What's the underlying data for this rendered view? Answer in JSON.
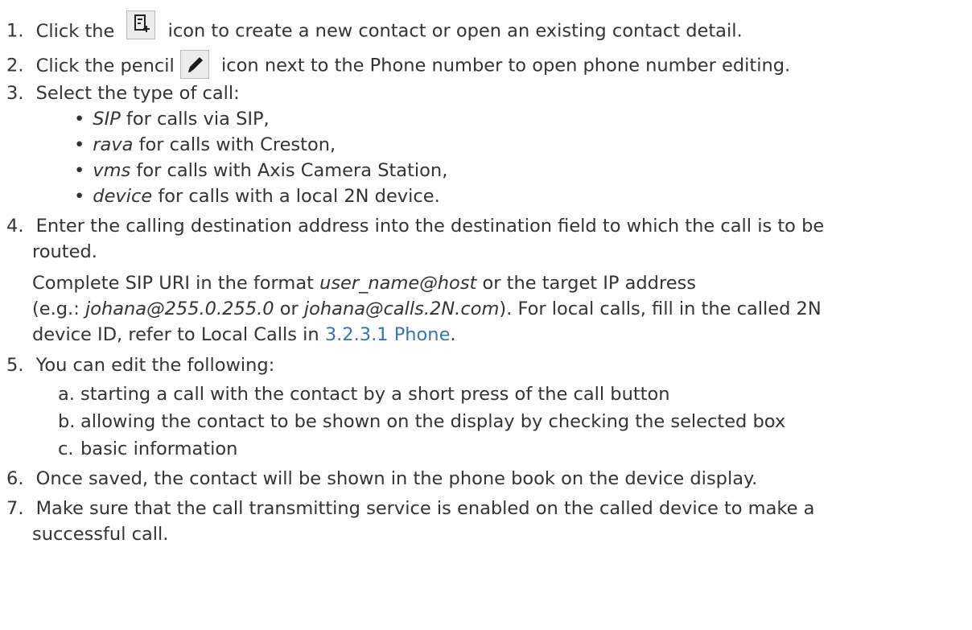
{
  "steps": [
    {
      "num": "1.",
      "parts": [
        "Click the ",
        "icon to create a new contact or open an existing contact detail."
      ],
      "icon": "add-contact-icon"
    },
    {
      "num": "2.",
      "parts": [
        "Click the pencil ",
        "icon next to the Phone number to open phone number editing."
      ],
      "icon": "pencil-icon"
    },
    {
      "num": "3.",
      "text": "Select the type of call:"
    },
    {
      "num": "4.",
      "lines": [
        "Enter the calling destination address into the destination field to which the call is to be",
        "routed."
      ]
    },
    {
      "num": "5.",
      "text": "You can edit the following:"
    },
    {
      "num": "6.",
      "text": "Once saved, the contact will be shown in the phone book on the device display."
    },
    {
      "num": "7.",
      "lines": [
        "Make sure that the call transmitting service is enabled on the called device to make a",
        "successful call."
      ]
    }
  ],
  "call_types": [
    {
      "term": "SIP",
      "rest": " for calls via SIP,"
    },
    {
      "term": "rava",
      "rest": " for calls with Creston,"
    },
    {
      "term": "vms",
      "rest": " for calls with Axis Camera Station,"
    },
    {
      "term": "device",
      "rest": " for calls with a local 2N device."
    }
  ],
  "step4_detail": {
    "l1_a": "Complete SIP URI in the format ",
    "l1_em": "user_name@host",
    "l1_b": " or the target IP address",
    "l2_a": "(e.g.: ",
    "l2_em1": "johana@255.0.255.0",
    "l2_b": " or ",
    "l2_em2": "johana@calls.2N.com",
    "l2_c": "). For local calls, fill in the called 2N",
    "l3_a": "device ID, refer to Local Calls in ",
    "l3_link": "3.2.3.1 Phone",
    "l3_b": "."
  },
  "edit_options": [
    {
      "letter": "a.",
      "text": "starting a call with the contact by a short press of the call button"
    },
    {
      "letter": "b.",
      "text": "allowing the contact to be shown on the display by checking the selected box"
    },
    {
      "letter": "c.",
      "text": "basic information"
    }
  ],
  "colors": {
    "text": "#333333",
    "link": "#3b73af"
  }
}
